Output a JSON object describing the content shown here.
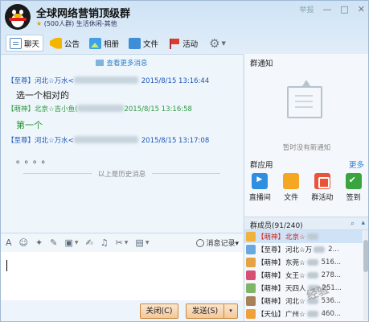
{
  "header": {
    "group_name": "全球网络营销顶级群",
    "sub_star": "★",
    "sub_text": "(500人群) 生活休闲-其他",
    "report": "举报",
    "minimize": "—",
    "maximize": "□",
    "close": "✕"
  },
  "tabs": [
    {
      "label": "聊天"
    },
    {
      "label": "公告"
    },
    {
      "label": "相册"
    },
    {
      "label": "文件"
    },
    {
      "label": "活动"
    }
  ],
  "chat": {
    "view_more": "查看更多消息",
    "messages": [
      {
        "role": "【至尊】",
        "name": "河北☆万水",
        "sep": "<",
        "time": "2015/8/15 13:16:44",
        "body": "选一个相对的"
      },
      {
        "role": "【萌神】",
        "name": "北京☆吉小鱼",
        "sep": "(",
        "time": "2015/8/15 13:16:58",
        "body": "第一个"
      },
      {
        "role": "【至尊】",
        "name": "河北☆万水",
        "sep": "<",
        "time": "2015/8/15 13:17:08",
        "body": ""
      }
    ],
    "dots": "。。。。",
    "history_divider": "以上是历史消息"
  },
  "toolbar": {
    "history_label": "消息记录",
    "history_caret": "▾"
  },
  "bottom": {
    "close_label": "关闭(C)",
    "send_label": "发送(S)",
    "send_dropdown": "▾"
  },
  "side": {
    "notice_title": "群通知",
    "notice_empty": "暂时没有新通知",
    "apps_title": "群应用",
    "apps_more": "更多",
    "apps": [
      {
        "label": "直播间"
      },
      {
        "label": "文件"
      },
      {
        "label": "群活动"
      },
      {
        "label": "签到"
      }
    ],
    "members_title": "群成员(91/240)",
    "members": [
      {
        "role": "【萌神】",
        "name": "北京☆",
        "tail": "",
        "color": "#f0b23a"
      },
      {
        "role": "【至尊】",
        "name": "河北☆万",
        "tail": "2...",
        "color": "#6aa9e0"
      },
      {
        "role": "【萌神】",
        "name": "东莞☆",
        "tail": "516...",
        "color": "#e5a343"
      },
      {
        "role": "【萌神】",
        "name": "女王☆",
        "tail": "278...",
        "color": "#d84f74"
      },
      {
        "role": "【萌神】",
        "name": "天四人",
        "tail": "251...",
        "color": "#7fb566"
      },
      {
        "role": "【萌神】",
        "name": "河北☆",
        "tail": "536...",
        "color": "#a88156"
      },
      {
        "role": "【天仙】",
        "name": "广州☆",
        "tail": "460...",
        "color": "#f0a13a"
      }
    ]
  },
  "watermark": "经验"
}
